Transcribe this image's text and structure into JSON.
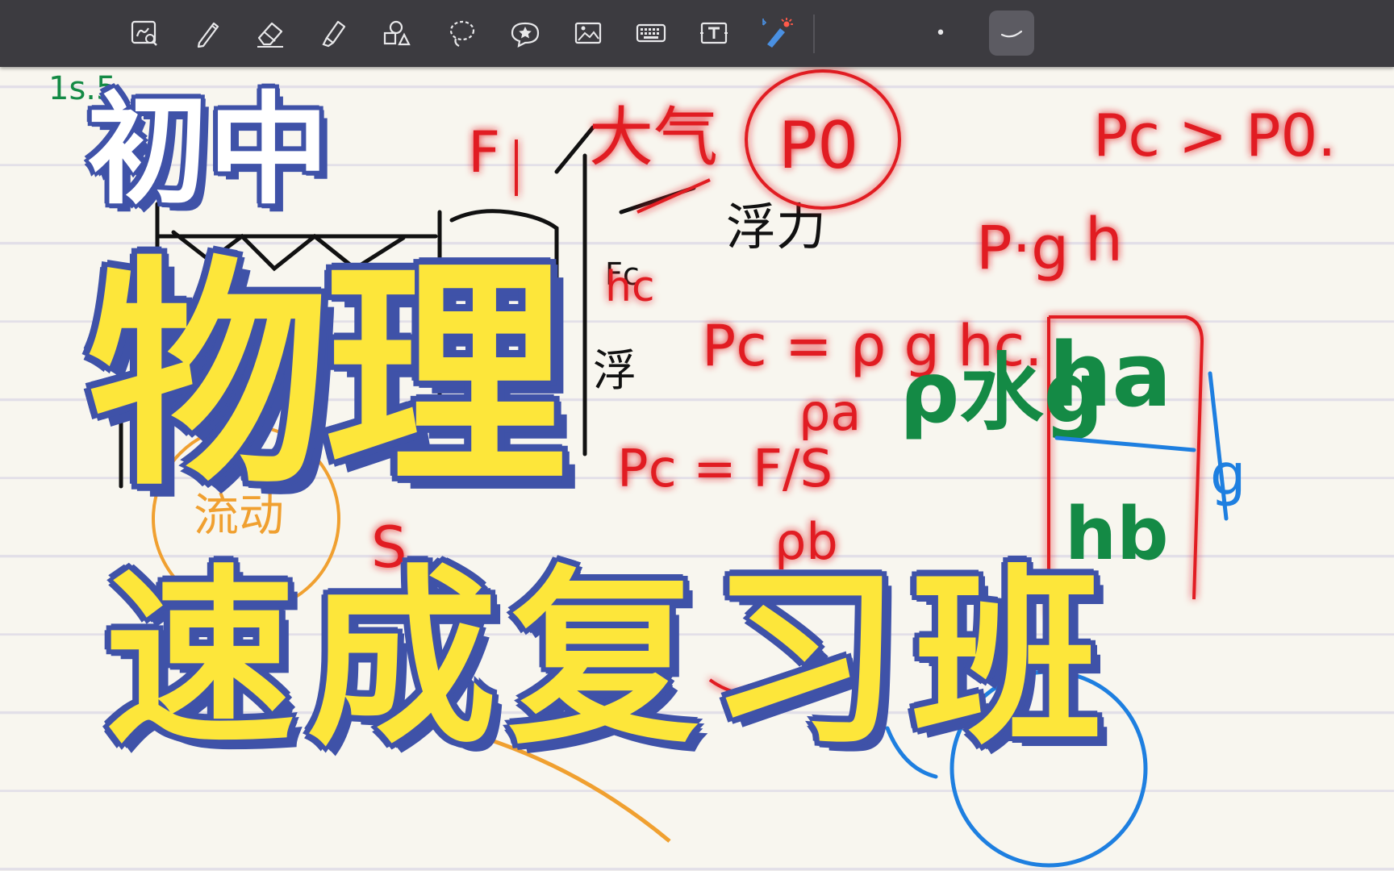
{
  "toolbar": {
    "tools": [
      {
        "name": "lasso-zoom-tool",
        "icon": "zoom-lasso-icon"
      },
      {
        "name": "pen-tool",
        "icon": "pen-icon"
      },
      {
        "name": "eraser-tool",
        "icon": "eraser-icon"
      },
      {
        "name": "highlighter-tool",
        "icon": "highlighter-icon"
      },
      {
        "name": "shapes-tool",
        "icon": "shapes-icon"
      },
      {
        "name": "lasso-tool",
        "icon": "lasso-icon"
      },
      {
        "name": "sticker-tool",
        "icon": "star-sticker-icon"
      },
      {
        "name": "image-tool",
        "icon": "image-icon"
      },
      {
        "name": "keyboard-tool",
        "icon": "keyboard-icon"
      },
      {
        "name": "text-tool",
        "icon": "text-box-icon"
      },
      {
        "name": "laser-pointer-tool",
        "icon": "laser-pointer-icon"
      }
    ],
    "stroke_dot": "•",
    "colors": {
      "bar": "#3c3b40",
      "active": "#5c5b62",
      "laser": "#4a90e2"
    }
  },
  "headline": {
    "small": "初中",
    "main": "物理",
    "sub": "速成复习班",
    "colors": {
      "fill_main": "#fde63a",
      "fill_small": "#ffffff",
      "outline": "#3f52a8"
    }
  },
  "ink": {
    "red_notes": [
      "Pc > P0.",
      "大气",
      "P0",
      "F",
      "Pc = ρ g hc.",
      "Pc = F/S",
      "ρa",
      "ρb",
      "hc",
      "S",
      "P·g",
      "h"
    ],
    "black_notes": [
      "浮力",
      "Fc",
      "浮"
    ],
    "green_notes": [
      "ρ水g",
      "ha",
      "hb",
      "1s.5"
    ],
    "blue_notes": [
      "g"
    ],
    "orange_notes": [
      "流动"
    ],
    "colors": {
      "red": "#e11b22",
      "black": "#111111",
      "green": "#148a45",
      "blue": "#1e7fe0",
      "orange": "#f0a030"
    }
  }
}
